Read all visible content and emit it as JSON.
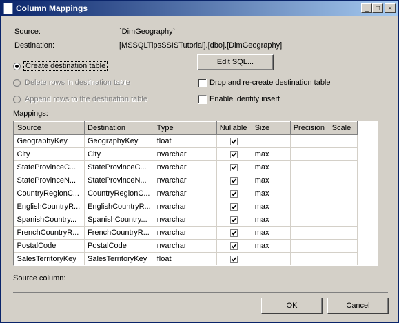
{
  "window": {
    "title": "Column Mappings",
    "minimize": "_",
    "maximize": "□",
    "close": "×"
  },
  "info": {
    "source_label": "Source:",
    "source_value": "`DimGeography`",
    "destination_label": "Destination:",
    "destination_value": "[MSSQLTipsSSISTutorial].[dbo].[DimGeography]"
  },
  "options": {
    "create_table": "Create destination table",
    "delete_rows": "Delete rows in destination table",
    "append_rows": "Append rows to the destination table",
    "edit_sql": "Edit SQL...",
    "drop_recreate": "Drop and re-create destination table",
    "identity_insert": "Enable identity insert",
    "selected_option": "create_table",
    "drop_recreate_checked": false,
    "identity_insert_checked": false
  },
  "mappings": {
    "label": "Mappings:",
    "columns": [
      "Source",
      "Destination",
      "Type",
      "Nullable",
      "Size",
      "Precision",
      "Scale"
    ],
    "rows": [
      {
        "source": "GeographyKey",
        "destination": "GeographyKey",
        "type": "float",
        "nullable": true,
        "size": "",
        "precision": "",
        "scale": ""
      },
      {
        "source": "City",
        "destination": "City",
        "type": "nvarchar",
        "nullable": true,
        "size": "max",
        "precision": "",
        "scale": ""
      },
      {
        "source": "StateProvinceC...",
        "destination": "StateProvinceC...",
        "type": "nvarchar",
        "nullable": true,
        "size": "max",
        "precision": "",
        "scale": ""
      },
      {
        "source": "StateProvinceN...",
        "destination": "StateProvinceN...",
        "type": "nvarchar",
        "nullable": true,
        "size": "max",
        "precision": "",
        "scale": ""
      },
      {
        "source": "CountryRegionC...",
        "destination": "CountryRegionC...",
        "type": "nvarchar",
        "nullable": true,
        "size": "max",
        "precision": "",
        "scale": ""
      },
      {
        "source": "EnglishCountryR...",
        "destination": "EnglishCountryR...",
        "type": "nvarchar",
        "nullable": true,
        "size": "max",
        "precision": "",
        "scale": ""
      },
      {
        "source": "SpanishCountry...",
        "destination": "SpanishCountry...",
        "type": "nvarchar",
        "nullable": true,
        "size": "max",
        "precision": "",
        "scale": ""
      },
      {
        "source": "FrenchCountryR...",
        "destination": "FrenchCountryR...",
        "type": "nvarchar",
        "nullable": true,
        "size": "max",
        "precision": "",
        "scale": ""
      },
      {
        "source": "PostalCode",
        "destination": "PostalCode",
        "type": "nvarchar",
        "nullable": true,
        "size": "max",
        "precision": "",
        "scale": ""
      },
      {
        "source": "SalesTerritoryKey",
        "destination": "SalesTerritoryKey",
        "type": "float",
        "nullable": true,
        "size": "",
        "precision": "",
        "scale": ""
      }
    ]
  },
  "footer": {
    "source_column_label": "Source column:",
    "ok": "OK",
    "cancel": "Cancel"
  }
}
